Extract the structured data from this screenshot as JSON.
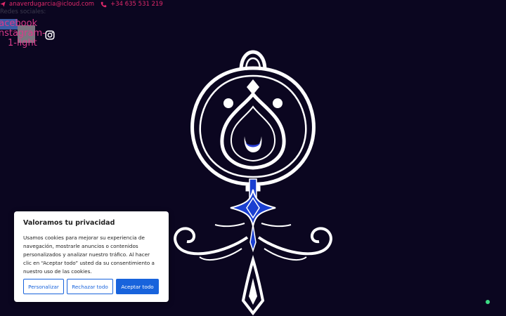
{
  "contact": {
    "email": "anaverdugarcia@icloud.com",
    "phone": "+34 635 531 219",
    "email_icon": "send-icon",
    "phone_icon": "phone-icon"
  },
  "social": {
    "label": "Redes sociales:",
    "facebook_text": "Facebook",
    "instagram_text": "Instagram-",
    "instagram_icon": "instagram-icon",
    "light_text": "1-light"
  },
  "colors": {
    "background": "#0b0620",
    "accent_text": "#e0296a",
    "primary_button": "#1863dc",
    "logo_blue": "#1a3fd1"
  },
  "cookie_banner": {
    "title": "Valoramos tu privacidad",
    "body": "Usamos cookies para mejorar su experiencia de navegación, mostrarle anuncios o contenidos personalizados y analizar nuestro tráfico. Al hacer clic en “Aceptar todo” usted da su consentimiento a nuestro uso de las cookies.",
    "customize_label": "Personalizar",
    "reject_label": "Rechazar todo",
    "accept_label": "Aceptar todo"
  }
}
